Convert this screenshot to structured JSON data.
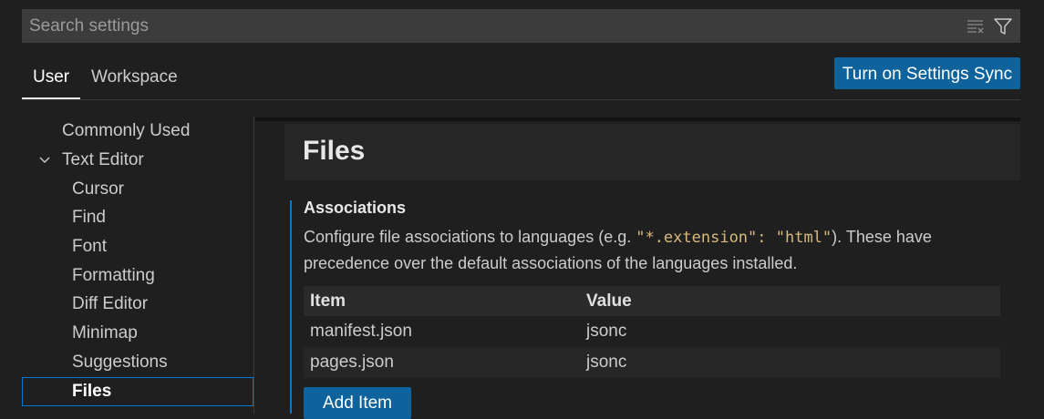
{
  "search": {
    "placeholder": "Search settings",
    "clear_icon": "clear-filter-icon",
    "filter_icon": "filter-icon"
  },
  "tabs": [
    {
      "label": "User",
      "active": true
    },
    {
      "label": "Workspace",
      "active": false
    }
  ],
  "sync_button": "Turn on Settings Sync",
  "toc": {
    "items": [
      {
        "label": "Commonly Used"
      },
      {
        "label": "Text Editor",
        "expanded": true
      },
      {
        "label": "Cursor"
      },
      {
        "label": "Find"
      },
      {
        "label": "Font"
      },
      {
        "label": "Formatting"
      },
      {
        "label": "Diff Editor"
      },
      {
        "label": "Minimap"
      },
      {
        "label": "Suggestions"
      },
      {
        "label": "Files",
        "selected": true
      }
    ]
  },
  "section": {
    "title": "Files"
  },
  "setting": {
    "name": "Associations",
    "desc_before": "Configure file associations to languages (e.g. ",
    "desc_code": "\"*.extension\": \"html\"",
    "desc_after": "). These have precedence over the default associations of the languages installed."
  },
  "table": {
    "headers": {
      "item": "Item",
      "value": "Value"
    },
    "rows": [
      {
        "item": "manifest.json",
        "value": "jsonc"
      },
      {
        "item": "pages.json",
        "value": "jsonc"
      }
    ]
  },
  "add_button": "Add Item",
  "colors": {
    "accent": "#0078d4",
    "button": "#0e639c",
    "code": "#d7ba7d"
  }
}
